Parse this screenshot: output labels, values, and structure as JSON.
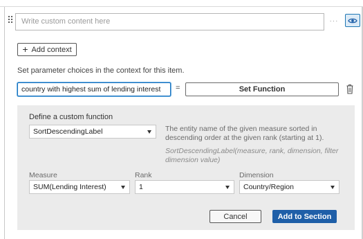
{
  "editor": {
    "custom_content_placeholder": "Write custom content here",
    "more_glyph": "···",
    "add_context_label": "Add context",
    "instruction": "Set parameter choices in the context for this item.",
    "parameter_value": "country with highest sum of lending interest",
    "equals": "=",
    "set_function_label": "Set Function"
  },
  "custom_function": {
    "title": "Define a custom function",
    "function_select": "SortDescendingLabel",
    "description": "The entity name of the given measure sorted in descending order at the given rank (starting at 1).",
    "signature": "SortDescendingLabel(measure, rank, dimension, filter dimension value)",
    "measure_label": "Measure",
    "measure_value": "SUM(Lending Interest)",
    "rank_label": "Rank",
    "rank_value": "1",
    "dimension_label": "Dimension",
    "dimension_value": "Country/Region",
    "cancel_label": "Cancel",
    "add_to_section_label": "Add to Section"
  },
  "colors": {
    "accent": "#1f5fa8",
    "focus_border": "#1a73c0",
    "panel_bg": "#ebebeb"
  },
  "icons": [
    "drag-handle-icon",
    "more-icon",
    "eye-icon",
    "plus-icon",
    "trash-icon",
    "caret-down-icon"
  ]
}
